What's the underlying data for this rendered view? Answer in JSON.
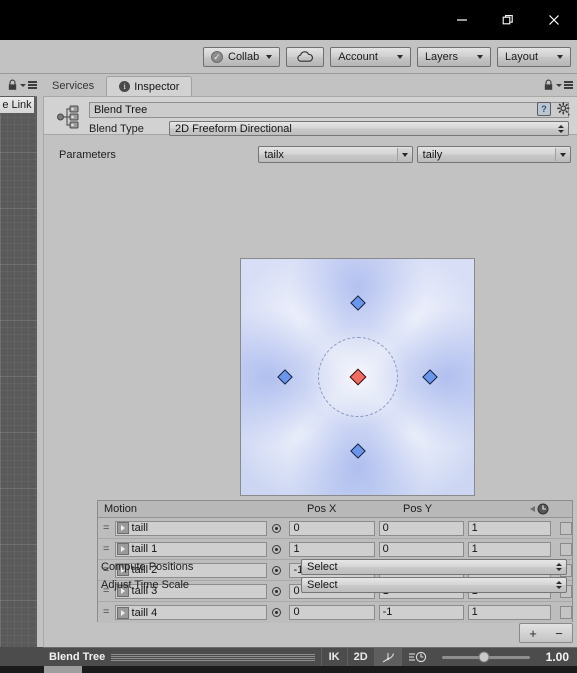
{
  "window": {
    "controls": [
      {
        "name": "minimize",
        "glyph": "minimize-icon"
      },
      {
        "name": "restore",
        "glyph": "restore-icon"
      },
      {
        "name": "close",
        "glyph": "close-icon"
      }
    ]
  },
  "toolbar": {
    "collab_label": "Collab",
    "cloud_label": "",
    "account_label": "Account",
    "layers_label": "Layers",
    "layout_label": "Layout"
  },
  "tabs": {
    "services_label": "Services",
    "inspector_label": "Inspector",
    "inspector_badge": "i"
  },
  "scene_sliver": {
    "link_button_label": "e Link"
  },
  "inspector": {
    "asset_name": "Blend Tree",
    "blend_type_label": "Blend Type",
    "blend_type_value": "2D Freeform Directional",
    "help_icon_label": "?",
    "parameters_label": "Parameters",
    "parameter_x": "tailx",
    "parameter_y": "taily"
  },
  "blend_view": {
    "points": [
      {
        "label": "taill",
        "x": 0,
        "y": 0,
        "selected": true
      },
      {
        "label": "taill 1",
        "x": 1,
        "y": 0,
        "selected": false
      },
      {
        "label": "taill 2",
        "x": -1,
        "y": 0,
        "selected": false
      },
      {
        "label": "taill 3",
        "x": 0,
        "y": 1,
        "selected": false
      },
      {
        "label": "taill 4",
        "x": 0,
        "y": -1,
        "selected": false
      }
    ],
    "axis_range": [
      -1.6,
      1.6
    ]
  },
  "motion_table": {
    "headers": {
      "motion": "Motion",
      "pos_x": "Pos X",
      "pos_y": "Pos Y",
      "speed": "speed-icon",
      "mirror": "mirror-icon"
    },
    "rows": [
      {
        "motion": "taill",
        "pos_x": "0",
        "pos_y": "0",
        "speed": "1",
        "mirror": false
      },
      {
        "motion": "taill 1",
        "pos_x": "1",
        "pos_y": "0",
        "speed": "1",
        "mirror": false
      },
      {
        "motion": "taill 2",
        "pos_x": "-1",
        "pos_y": "0",
        "speed": "1",
        "mirror": false
      },
      {
        "motion": "taill 3",
        "pos_x": "0",
        "pos_y": "1",
        "speed": "1",
        "mirror": false
      },
      {
        "motion": "taill 4",
        "pos_x": "0",
        "pos_y": "-1",
        "speed": "1",
        "mirror": false
      }
    ],
    "add_label": "+",
    "remove_label": "−"
  },
  "bottom_controls": {
    "compute_positions_label": "Compute Positions",
    "compute_positions_value": "Select",
    "adjust_time_scale_label": "Adjust Time Scale",
    "adjust_time_scale_value": "Select"
  },
  "animator_bar": {
    "title": "Blend Tree",
    "ik_label": "IK",
    "two_d_label": "2D",
    "playback_value": "1.00"
  },
  "colors": {
    "panel_bg": "#c2c2c2",
    "header_bg": "#d2d2d2",
    "field_bg": "#cfcfcf",
    "selected_point": "#f06b62",
    "point": "#6b96ea",
    "blend_field": "#ccd6f3",
    "animbar_bg": "#4c4c4c"
  }
}
